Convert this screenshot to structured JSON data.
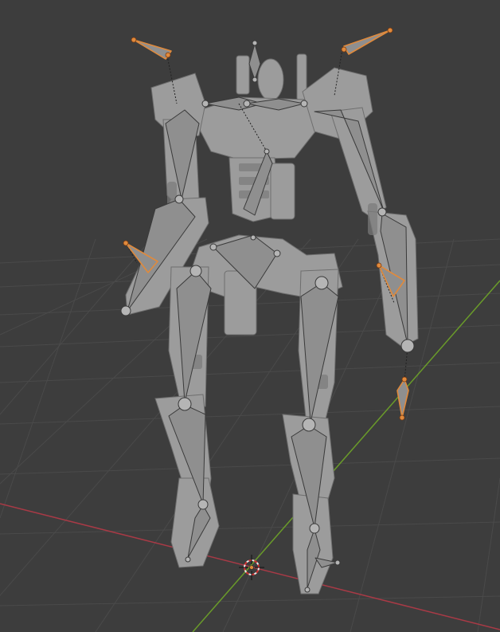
{
  "viewport": {
    "mode": "pose-mode",
    "colors": {
      "background": "#3d3d3d",
      "grid_line": "#4a4a4a",
      "x_axis": "#a83a46",
      "y_axis": "#6a9b2a",
      "mesh": "#9c9c9c",
      "mesh_dark": "#6e6e6e",
      "bone": "#8f8f8f",
      "bone_edge": "#3a3a3a",
      "selected": "#e08a3c"
    },
    "icons": [
      "3d-cursor-icon"
    ],
    "armature": {
      "bones_total": 24,
      "ik_targets_selected": 4
    }
  }
}
